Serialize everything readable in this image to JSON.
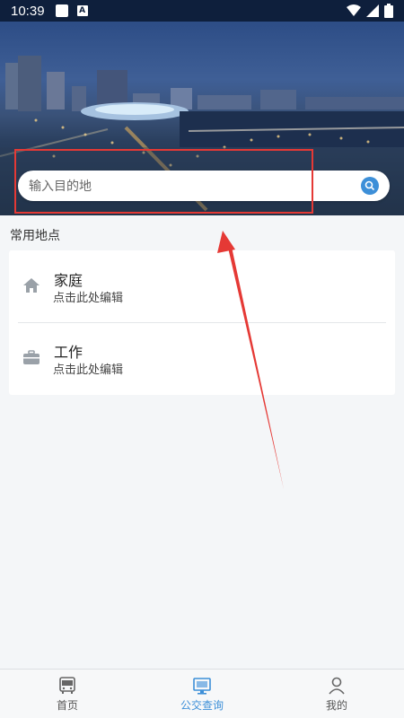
{
  "status_bar": {
    "time": "10:39"
  },
  "search": {
    "placeholder": "输入目的地"
  },
  "section": {
    "title": "常用地点"
  },
  "places": [
    {
      "name": "家庭",
      "hint": "点击此处编辑",
      "icon": "home-icon"
    },
    {
      "name": "工作",
      "hint": "点击此处编辑",
      "icon": "briefcase-icon"
    }
  ],
  "tabs": [
    {
      "label": "首页",
      "icon": "bus-icon",
      "active": false
    },
    {
      "label": "公交查询",
      "icon": "bus-screen-icon",
      "active": true
    },
    {
      "label": "我的",
      "icon": "user-icon",
      "active": false
    }
  ],
  "colors": {
    "accent": "#3d8fd8",
    "annotation": "#e53935",
    "status_bar": "#0e1f3c"
  }
}
